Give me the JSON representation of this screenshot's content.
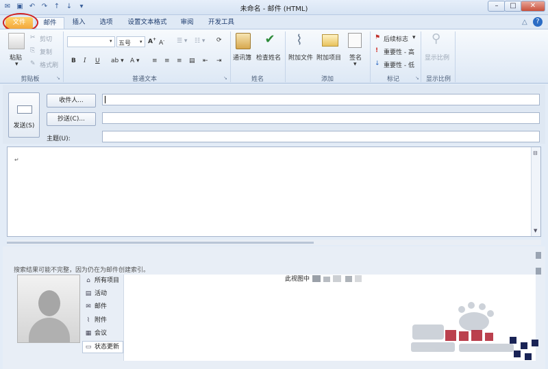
{
  "window": {
    "title": "未命名 - 邮件 (HTML)"
  },
  "tabs": [
    {
      "label": "文件"
    },
    {
      "label": "邮件"
    },
    {
      "label": "插入"
    },
    {
      "label": "选项"
    },
    {
      "label": "设置文本格式"
    },
    {
      "label": "审阅"
    },
    {
      "label": "开发工具"
    }
  ],
  "ribbon": {
    "clipboard": {
      "paste": "粘贴",
      "cut": "剪切",
      "copy": "复制",
      "format_painter": "格式刷",
      "group": "剪贴板"
    },
    "basic_text": {
      "font_size": "五号",
      "group": "普通文本"
    },
    "names": {
      "address_book": "通讯簿",
      "check_names": "检查姓名",
      "group": "姓名"
    },
    "include": {
      "attach_file": "附加文件",
      "attach_item": "附加项目",
      "signature": "签名",
      "group": "添加"
    },
    "tags": {
      "follow_up": "后续标志",
      "high": "重要性 - 高",
      "low": "重要性 - 低",
      "group": "标记"
    },
    "zoom": {
      "label": "显示比例",
      "group": "显示比例"
    }
  },
  "compose": {
    "send": "发送(S)",
    "to": "收件人...",
    "cc": "抄送(C)...",
    "subject": "主题(U):"
  },
  "people_pane": {
    "notice": "搜索结果可能不完整，因为仍在为邮件创建索引。",
    "view_text": "此视图中",
    "nav": [
      {
        "label": "所有项目",
        "icon": "home-icon"
      },
      {
        "label": "活动",
        "icon": "list-icon"
      },
      {
        "label": "邮件",
        "icon": "mail-icon"
      },
      {
        "label": "附件",
        "icon": "paperclip-icon"
      },
      {
        "label": "会议",
        "icon": "calendar-icon"
      },
      {
        "label": "状态更新",
        "icon": "comment-icon"
      }
    ]
  },
  "colors": {
    "file_tab": "#f3a73b",
    "ribbon_bg": "#dde8f5",
    "annotation_circle": "#d02020"
  }
}
